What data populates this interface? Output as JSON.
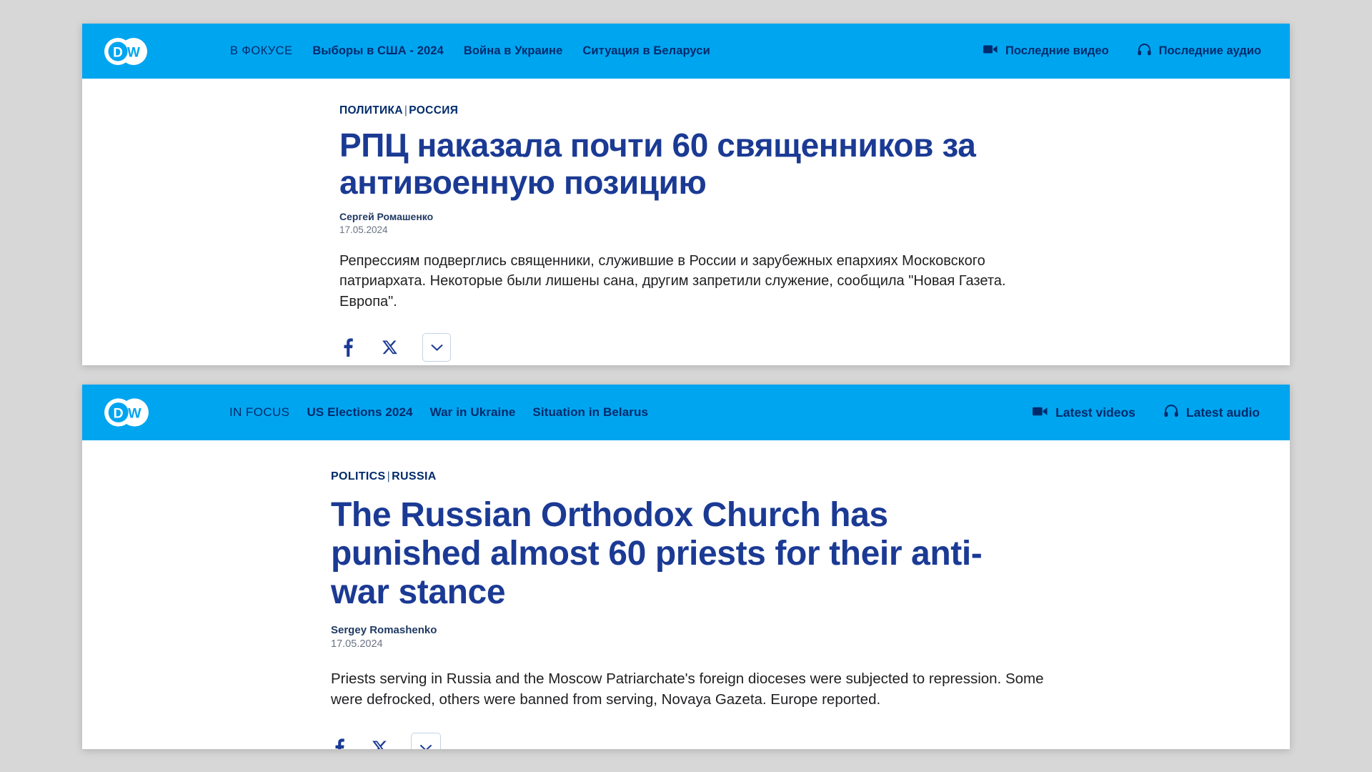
{
  "panels": [
    {
      "lang": "ru",
      "header": {
        "logo_alt": "DW",
        "nav": [
          {
            "label": "В ФОКУСЕ",
            "kind": "infocus"
          },
          {
            "label": "Выборы в США - 2024",
            "kind": "topic"
          },
          {
            "label": "Война в Украине",
            "kind": "topic"
          },
          {
            "label": "Ситуация в Беларуси",
            "kind": "topic"
          }
        ],
        "media": [
          {
            "label": "Последние видео",
            "icon": "video-camera-icon"
          },
          {
            "label": "Последние аудио",
            "icon": "headphones-icon"
          }
        ]
      },
      "article": {
        "kicker_primary": "ПОЛИТИКА",
        "kicker_separator": "|",
        "kicker_secondary": "РОССИЯ",
        "headline": "РПЦ наказала почти 60 священников за антивоенную позицию",
        "author": "Сергей Ромашенко",
        "date": "17.05.2024",
        "standfirst": "Репрессиям подверглись священники, служившие в России и зарубежных епархиях Московского патриархата. Некоторые были лишены сана, другим запретили служение, сообщила \"Новая Газета. Европа\"."
      },
      "share": {
        "facebook_label": "f",
        "x_label": "X",
        "more_label": "chevron-down"
      }
    },
    {
      "lang": "en",
      "header": {
        "logo_alt": "DW",
        "nav": [
          {
            "label": "IN FOCUS",
            "kind": "infocus"
          },
          {
            "label": "US Elections 2024",
            "kind": "topic"
          },
          {
            "label": "War in Ukraine",
            "kind": "topic"
          },
          {
            "label": "Situation in Belarus",
            "kind": "topic"
          }
        ],
        "media": [
          {
            "label": "Latest videos",
            "icon": "video-camera-icon"
          },
          {
            "label": "Latest audio",
            "icon": "headphones-icon"
          }
        ]
      },
      "article": {
        "kicker_primary": "POLITICS",
        "kicker_separator": "|",
        "kicker_secondary": "RUSSIA",
        "headline": "The Russian Orthodox Church has punished almost 60 priests for their anti-war stance",
        "author": "Sergey Romashenko",
        "date": "17.05.2024",
        "standfirst": "Priests serving in Russia and the Moscow Patriarchate's foreign dioceses were subjected to repression. Some were defrocked, others were banned from serving, Novaya Gazeta. Europe reported."
      },
      "share": {
        "facebook_label": "f",
        "x_label": "X",
        "more_label": "chevron-down"
      }
    }
  ],
  "colors": {
    "brand_blue": "#00a5f0",
    "headline_blue": "#1b3a94",
    "nav_text": "#002b6b",
    "page_background": "#d7d7d7",
    "panel_background": "#ffffff"
  }
}
